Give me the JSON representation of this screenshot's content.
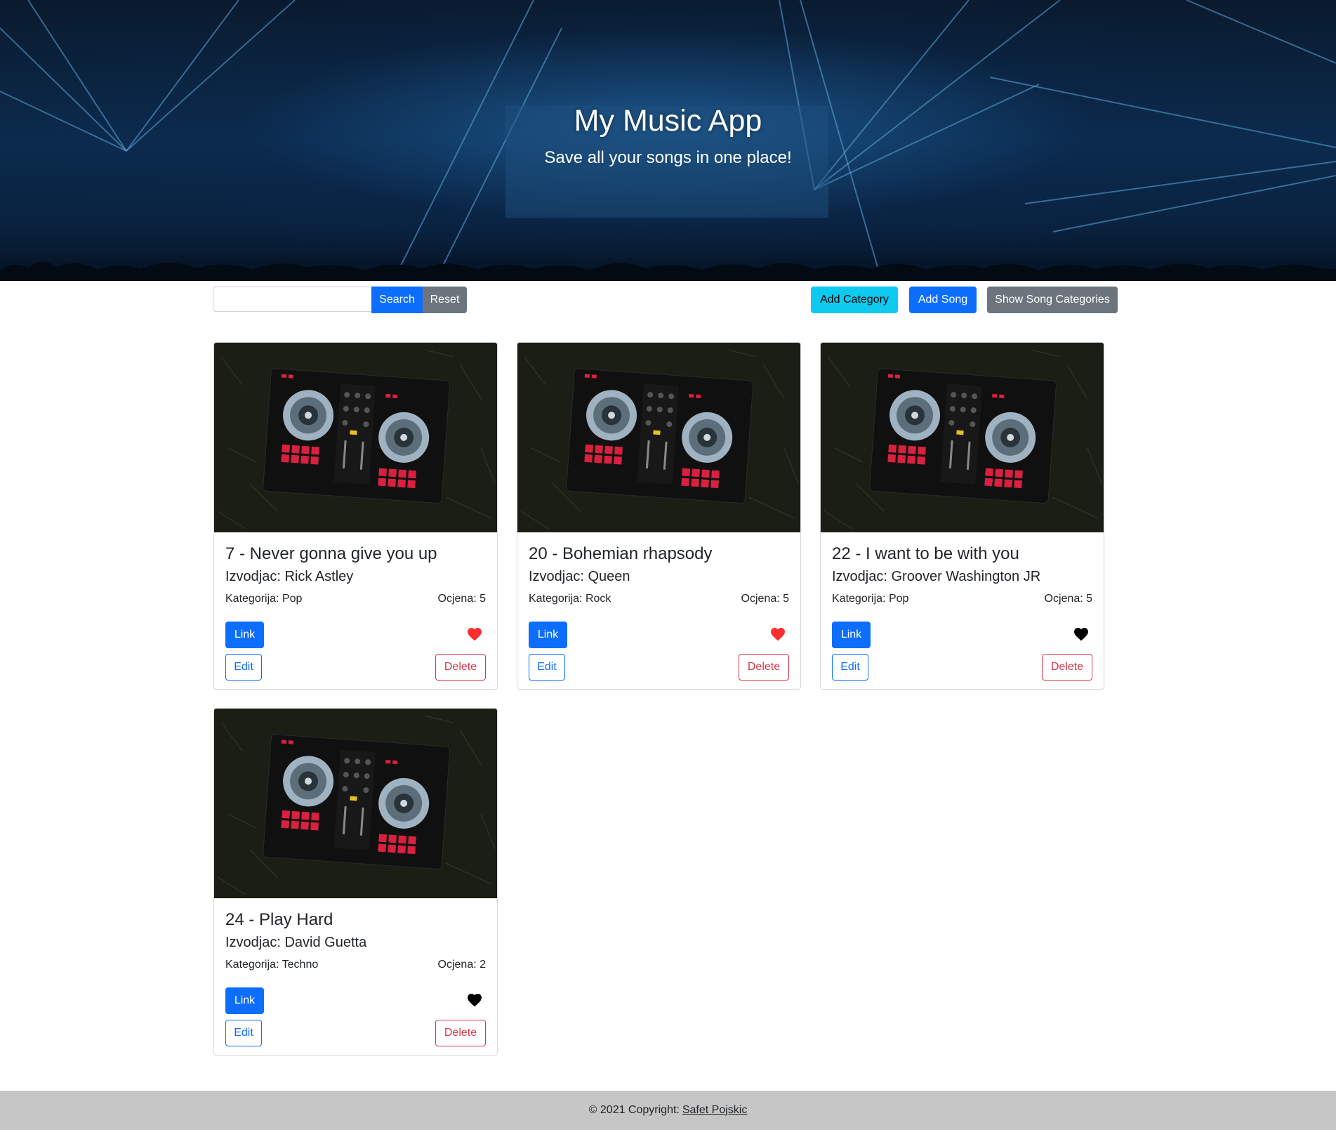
{
  "hero": {
    "title": "My Music App",
    "subtitle": "Save all your songs in one place!"
  },
  "toolbar": {
    "search_placeholder": "",
    "search_label": "Search",
    "reset_label": "Reset",
    "add_category_label": "Add Category",
    "add_song_label": "Add Song",
    "show_categories_label": "Show Song Categories"
  },
  "songs": [
    {
      "title": "7 - Never gonna give you up",
      "artist": "Izvodjac: Rick Astley",
      "category": "Kategorija: Pop",
      "rating": "Ocjena: 5",
      "favorite": true,
      "link_label": "Link",
      "edit_label": "Edit",
      "delete_label": "Delete"
    },
    {
      "title": "20 - Bohemian rhapsody",
      "artist": "Izvodjac: Queen",
      "category": "Kategorija: Rock",
      "rating": "Ocjena: 5",
      "favorite": true,
      "link_label": "Link",
      "edit_label": "Edit",
      "delete_label": "Delete"
    },
    {
      "title": "22 - I want to be with you",
      "artist": "Izvodjac: Groover Washington JR",
      "category": "Kategorija: Pop",
      "rating": "Ocjena: 5",
      "favorite": false,
      "link_label": "Link",
      "edit_label": "Edit",
      "delete_label": "Delete"
    },
    {
      "title": "24 - Play Hard",
      "artist": "Izvodjac: David Guetta",
      "category": "Kategorija: Techno",
      "rating": "Ocjena: 2",
      "favorite": false,
      "link_label": "Link",
      "edit_label": "Edit",
      "delete_label": "Delete"
    }
  ],
  "footer": {
    "copyright": "© 2021 Copyright:",
    "author": "Safet Pojskic"
  },
  "colors": {
    "primary": "#0d6efd",
    "secondary": "#6c757d",
    "info": "#0dcaf0",
    "danger": "#dc3545",
    "heart_favorite": "#ff2e2e",
    "heart_default": "#000000",
    "footer_bg": "#c6c6c6"
  },
  "icons": {
    "favorite": "heart-icon"
  }
}
